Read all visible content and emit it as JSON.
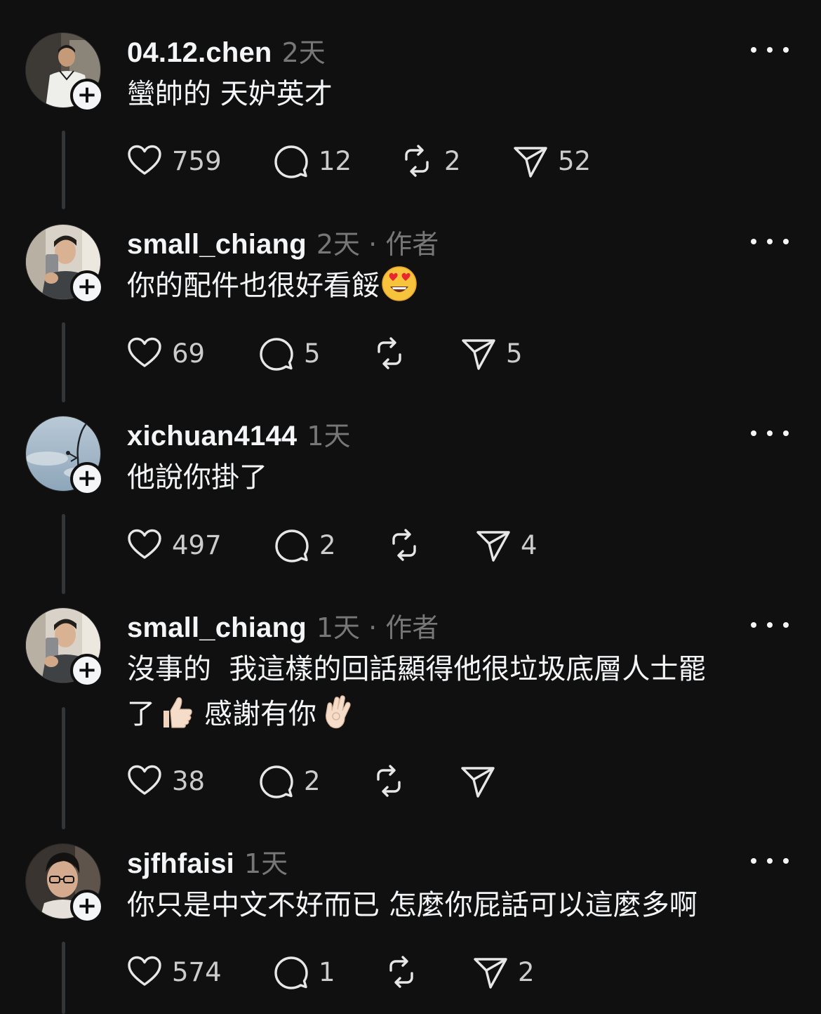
{
  "theme": {
    "background": "#101010",
    "text": "#f3f5f7",
    "meta": "#777777",
    "thread_line": "#333638"
  },
  "posts": [
    {
      "username": "04.12.chen",
      "meta": "2天",
      "text_lines": [
        "蠻帥的 天妒英才"
      ],
      "likes": "759",
      "replies": "12",
      "reposts": "2",
      "shares": "52",
      "avatar": "avatar-photo-boy-white-tee"
    },
    {
      "username": "small_chiang",
      "meta": "2天 · 作者",
      "text_lines": [
        "你的配件也很好看餒"
      ],
      "emoji_after": "heart-eyes-emoji",
      "likes": "69",
      "replies": "5",
      "reposts": "",
      "shares": "5",
      "avatar": "avatar-photo-mirror-selfie"
    },
    {
      "username": "xichuan4144",
      "meta": "1天",
      "text_lines": [
        "他說你掛了"
      ],
      "likes": "497",
      "replies": "2",
      "reposts": "",
      "shares": "4",
      "avatar": "avatar-photo-sky-tree"
    },
    {
      "username": "small_chiang",
      "meta": "1天 · 作者",
      "text_lines": [
        "沒事的  我這樣的回話顯得他很垃圾底層人士罷",
        "了",
        "感謝有你"
      ],
      "likes": "38",
      "replies": "2",
      "reposts": "",
      "shares": "",
      "avatar": "avatar-photo-mirror-selfie"
    },
    {
      "username": "sjfhfaisi",
      "meta": "1天",
      "text_lines": [
        "你只是中文不好而已 怎麼你屁話可以這麼多啊"
      ],
      "likes": "574",
      "replies": "1",
      "reposts": "",
      "shares": "2",
      "avatar": "avatar-photo-glasses-man"
    }
  ],
  "icons": {
    "like": "heart-icon",
    "reply": "comment-bubble-icon",
    "repost": "repost-icon",
    "share": "send-icon",
    "more": "more-dots-icon",
    "follow": "plus-icon"
  }
}
